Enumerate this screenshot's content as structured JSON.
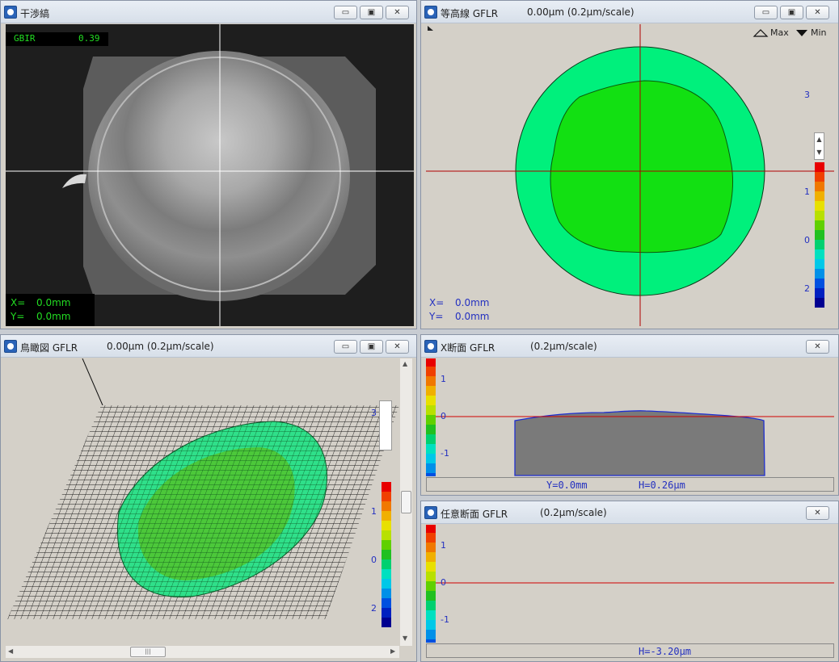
{
  "interference": {
    "title": "干渉縞",
    "gbir_label": "GBIR",
    "gbir_value": "0.39",
    "x_label": "X=",
    "x_value": "0.0mm",
    "y_label": "Y=",
    "y_value": "0.0mm"
  },
  "contour": {
    "title": "等高線 GFLR",
    "scale": "0.00μm (0.2μm/scale)",
    "legend_max": "Max",
    "legend_min": "Min",
    "tick_3": "3",
    "tick_1": "1",
    "tick_0": "0",
    "tick_2": "2",
    "x_label": "X=",
    "x_value": "0.0mm",
    "y_label": "Y=",
    "y_value": "0.0mm"
  },
  "bird": {
    "title": "鳥瞰図 GFLR",
    "scale": "0.00μm (0.2μm/scale)",
    "tick_3": "3",
    "tick_1": "1",
    "tick_0": "0",
    "tick_2": "2",
    "scroll_grip": "|||"
  },
  "xsection": {
    "title": "X断面 GFLR",
    "scale": "(0.2μm/scale)",
    "tick_1": "1",
    "tick_0": "0",
    "tick_m1": "-1",
    "status_y": "Y=0.0mm",
    "status_h": "H=0.26μm"
  },
  "arbsection": {
    "title": "任意断面 GFLR",
    "scale": "(0.2μm/scale)",
    "tick_1": "1",
    "tick_0": "0",
    "tick_m1": "-1",
    "status_h": "H=-3.20μm"
  },
  "window_buttons": {
    "minimize": "▭",
    "maximize": "▣",
    "close": "✕"
  },
  "colors": {
    "title_bg": "#dde4ee",
    "panel_bg": "#d4d0c8",
    "contour_outer": "#00f07c",
    "contour_inner": "#10e010",
    "crosshair": "#b00000",
    "label_blue": "#2330c0",
    "green_text": "#22dd22"
  },
  "colorbar": [
    "#e80000",
    "#f04000",
    "#f07800",
    "#f0b000",
    "#e8e000",
    "#b8e000",
    "#60d000",
    "#20c020",
    "#00d070",
    "#00e0c0",
    "#00c8e8",
    "#0090e8",
    "#0050e0",
    "#0020c0",
    "#000090"
  ]
}
